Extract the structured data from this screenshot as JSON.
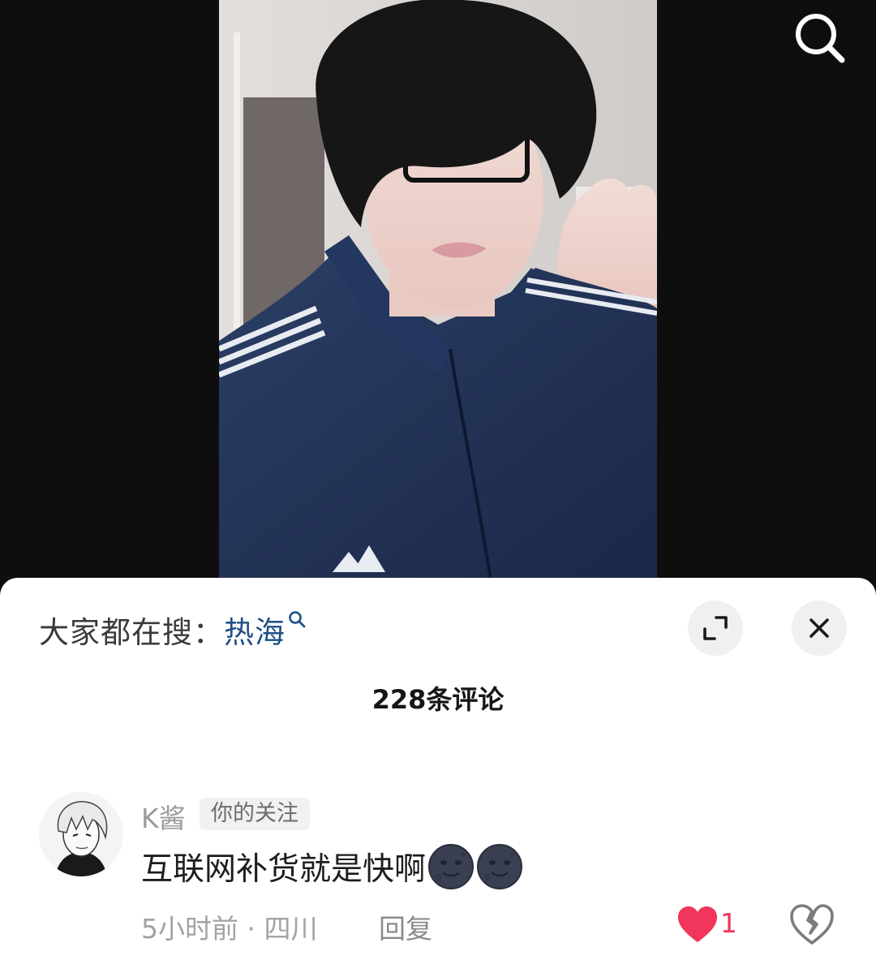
{
  "hot_search": {
    "prefix": "大家都在搜：",
    "term": "热海",
    "term_color": "#1f4f86"
  },
  "comments_header": {
    "count_label": "228条评论"
  },
  "comment": {
    "username": "K酱",
    "badge": "你的关注",
    "text": "互联网补货就是快啊",
    "emojis": [
      "new-moon-face",
      "new-moon-face"
    ],
    "meta": "5小时前 · 四川",
    "reply_label": "回复",
    "like_count": "1",
    "liked": true,
    "like_color": "#f2355a"
  },
  "icons": {
    "top_right": "search-icon",
    "sheet_expand": "expand-icon",
    "sheet_close": "close-icon",
    "like": "heart-icon",
    "dislike": "broken-heart-icon"
  }
}
